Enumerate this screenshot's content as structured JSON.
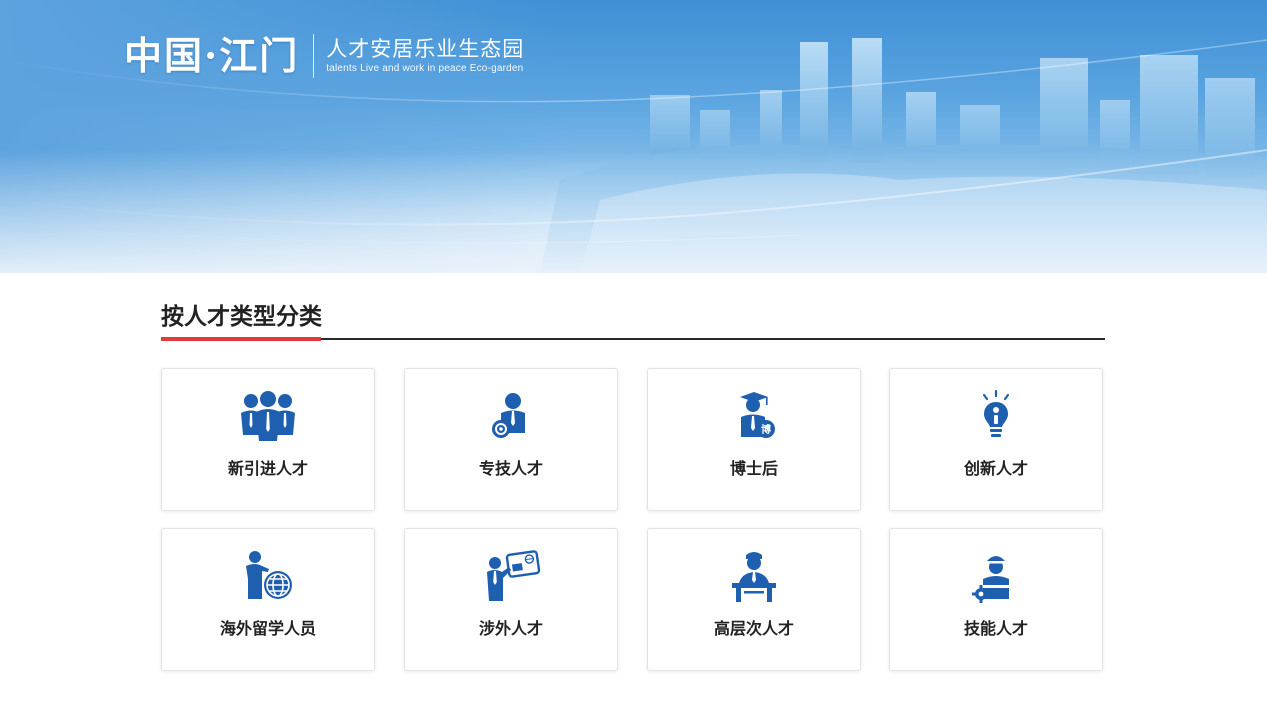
{
  "header": {
    "logo_text": "中国·江门",
    "title": "人才安居乐业生态园",
    "subtitle": "talents Live and work in peace Eco-garden"
  },
  "section": {
    "title": "按人才类型分类"
  },
  "categories": [
    {
      "label": "新引进人才",
      "icon": "people-group-icon"
    },
    {
      "label": "专技人才",
      "icon": "professional-badge-icon"
    },
    {
      "label": "博士后",
      "icon": "graduate-doctor-icon"
    },
    {
      "label": "创新人才",
      "icon": "lightbulb-person-icon"
    },
    {
      "label": "海外留学人员",
      "icon": "person-globe-icon"
    },
    {
      "label": "涉外人才",
      "icon": "person-id-card-icon"
    },
    {
      "label": "高层次人才",
      "icon": "speaker-podium-icon"
    },
    {
      "label": "技能人才",
      "icon": "worker-gear-icon"
    }
  ],
  "colors": {
    "icon": "#1f5fb0",
    "accent": "#e03a3a",
    "divider": "#2b2b2b"
  }
}
